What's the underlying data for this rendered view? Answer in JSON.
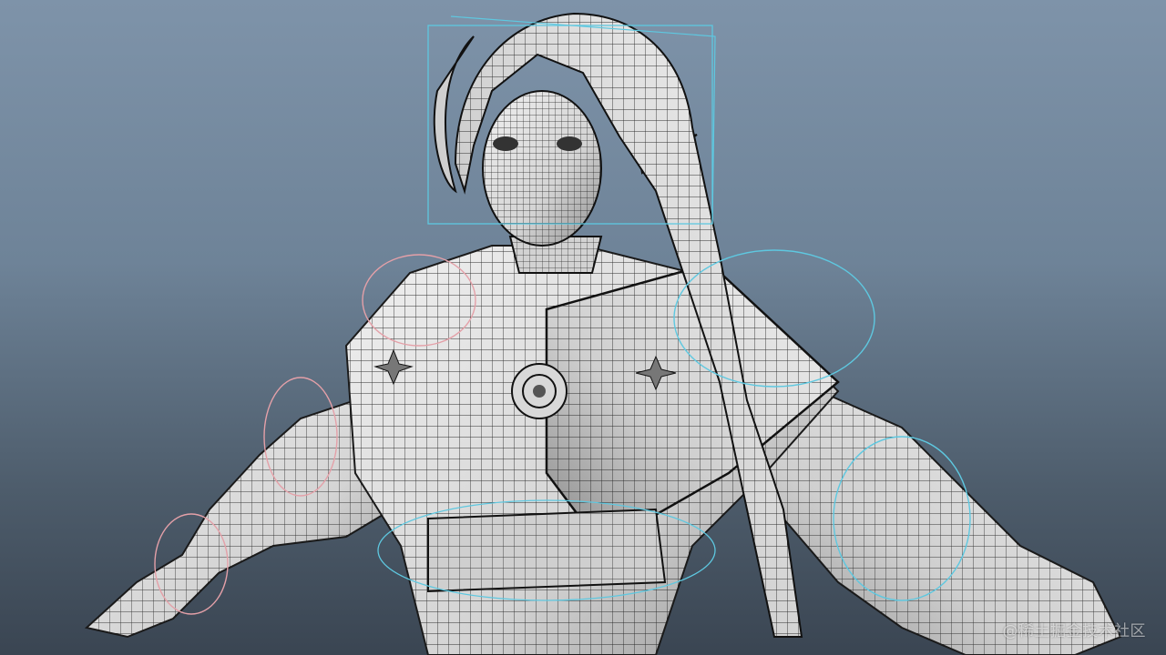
{
  "viewport": {
    "description_hidden": "",
    "watermark": "@稀土掘金技术社区"
  },
  "colors": {
    "bg_top": "#7e93a9",
    "bg_bottom": "#3a4552",
    "mesh_fill": "#e2e2e2",
    "mesh_shade": "#9a9a9a",
    "wire": "#1a1a1a",
    "control_cyan": "#5ec8e0",
    "control_pink": "#e4a0a8"
  },
  "icons": {
    "character": "3d-character-wireframe-model",
    "controls": "rig-control-curves"
  }
}
